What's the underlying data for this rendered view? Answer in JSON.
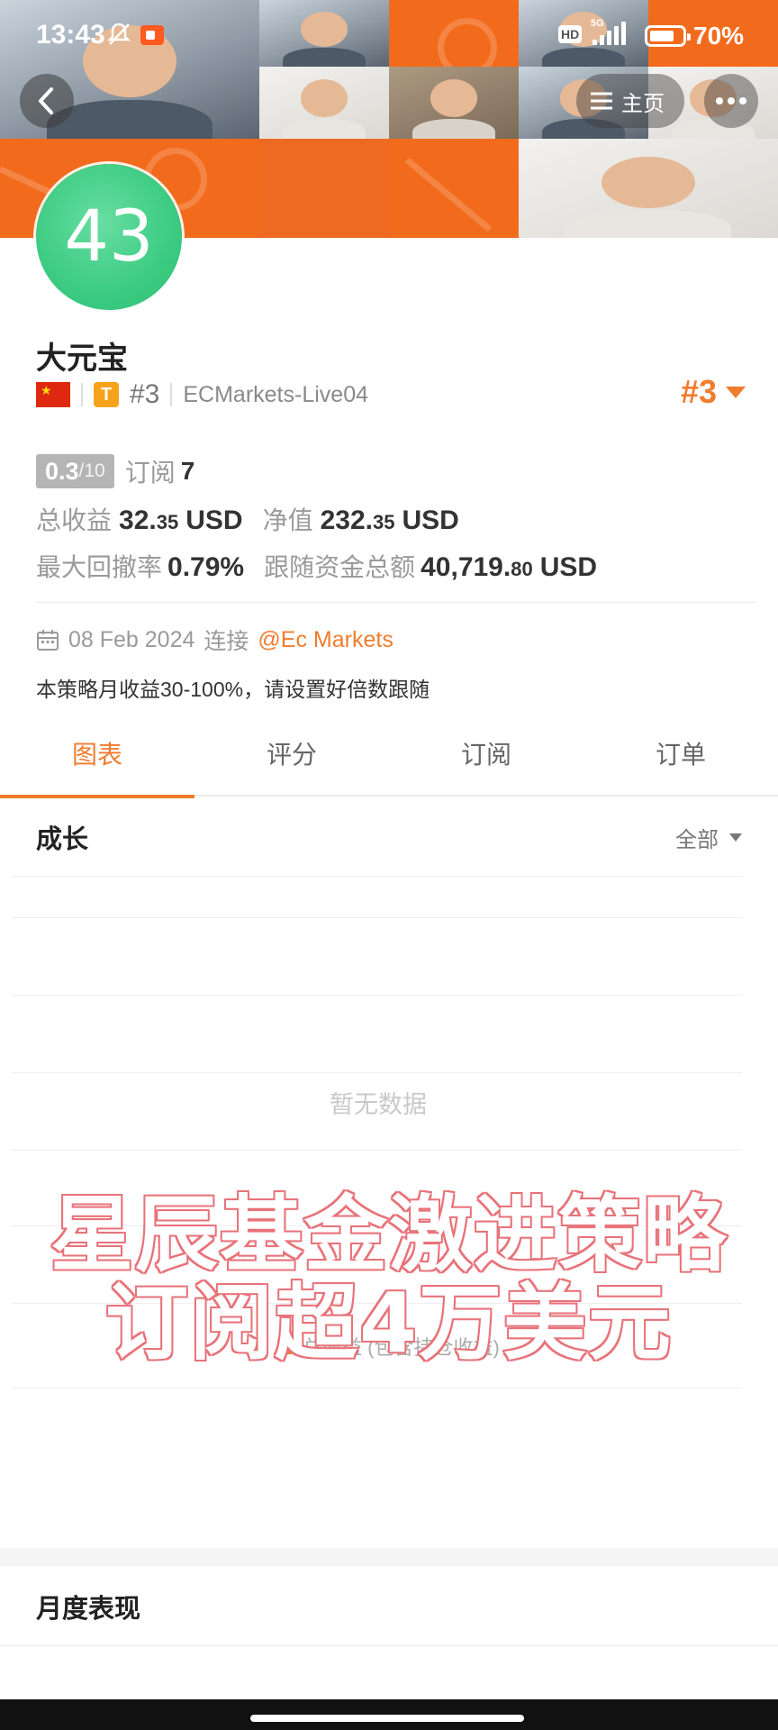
{
  "status_bar": {
    "time": "13:43",
    "network": "5G",
    "hd": "HD",
    "battery": "70%"
  },
  "header": {
    "home_label": "主页"
  },
  "profile": {
    "avatar_number": "43",
    "name": "大元宝",
    "country": "China",
    "tier_badge": "T",
    "rank_small": "#3",
    "server": "ECMarkets-Live04",
    "rank_big": "#3",
    "score_value": "0.3",
    "score_total": "/10",
    "subscribe_label": "订阅",
    "subscribe_count": "7",
    "total_profit_label": "总收益",
    "total_profit_int": "32.",
    "total_profit_dec": "35",
    "total_profit_unit": "USD",
    "net_value_label": "净值",
    "net_value_int": "232.",
    "net_value_dec": "35",
    "net_value_unit": "USD",
    "max_drawdown_label": "最大回撤率",
    "max_drawdown_value": "0.79%",
    "follow_funds_label": "跟随资金总额",
    "follow_funds_int": "40,719.",
    "follow_funds_dec": "80",
    "follow_funds_unit": "USD",
    "connect_date": "08 Feb 2024",
    "connect_label": "连接",
    "broker_link": "@Ec Markets",
    "description": "本策略月收益30-100%，请设置好倍数跟随"
  },
  "tabs": [
    {
      "label": "图表",
      "active": true
    },
    {
      "label": "评分",
      "active": false
    },
    {
      "label": "订阅",
      "active": false
    },
    {
      "label": "订单",
      "active": false
    }
  ],
  "growth": {
    "title": "成长",
    "filter_label": "全部",
    "empty_text": "暂无数据",
    "legend_label": "总收益 (包含持仓收益)"
  },
  "overlay": {
    "line1": "星辰基金激进策略",
    "line2": "订阅超4万美元"
  },
  "monthly": {
    "title": "月度表现"
  },
  "colors": {
    "accent": "#f07c2e",
    "banner": "#f36a1b",
    "avatar": "#3ccb82",
    "overlay_stroke": "#e8737a"
  }
}
